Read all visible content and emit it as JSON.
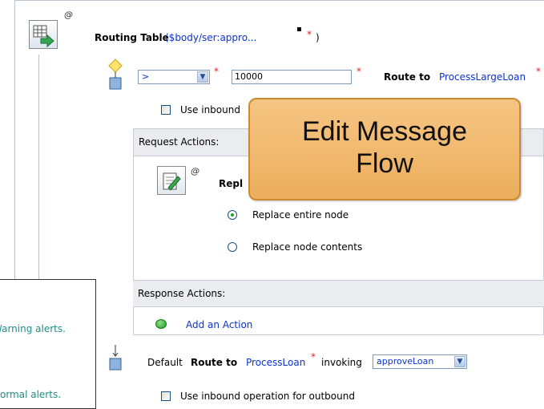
{
  "routing_table": {
    "label": "Routing Table",
    "expression": "($body/ser:appro...",
    "expression_suffix": " )",
    "annotation": "@",
    "required": "*",
    "info_glyph": "▪"
  },
  "route1": {
    "operator": ">",
    "value": "10000",
    "required": "*",
    "route_label": "Route to",
    "service": "ProcessLargeLoan",
    "use_inbound_label": "Use inbound"
  },
  "request_actions": {
    "header": "Request Actions:",
    "replace_label": "Repl",
    "annotation": "@",
    "options": [
      {
        "label": "Replace entire node",
        "selected": true
      },
      {
        "label": "Replace node contents",
        "selected": false
      }
    ]
  },
  "response_actions": {
    "header": "Response Actions:",
    "add_action": "Add an Action"
  },
  "default_route": {
    "prefix": "Default",
    "route_label": "Route to",
    "service": "ProcessLoan",
    "required": "*",
    "invoking": "invoking",
    "operation": "approveLoan",
    "use_inbound_label": "Use inbound operation for outbound"
  },
  "callout": {
    "line1": "Edit Message",
    "line2": "Flow"
  },
  "alerts": {
    "warning": "Warning alerts.",
    "normal": "Normal alerts."
  },
  "colors": {
    "link": "#0a33cc",
    "required": "#e0232b",
    "callout": "#f0b96e",
    "alert_text": "#1b8f86"
  }
}
